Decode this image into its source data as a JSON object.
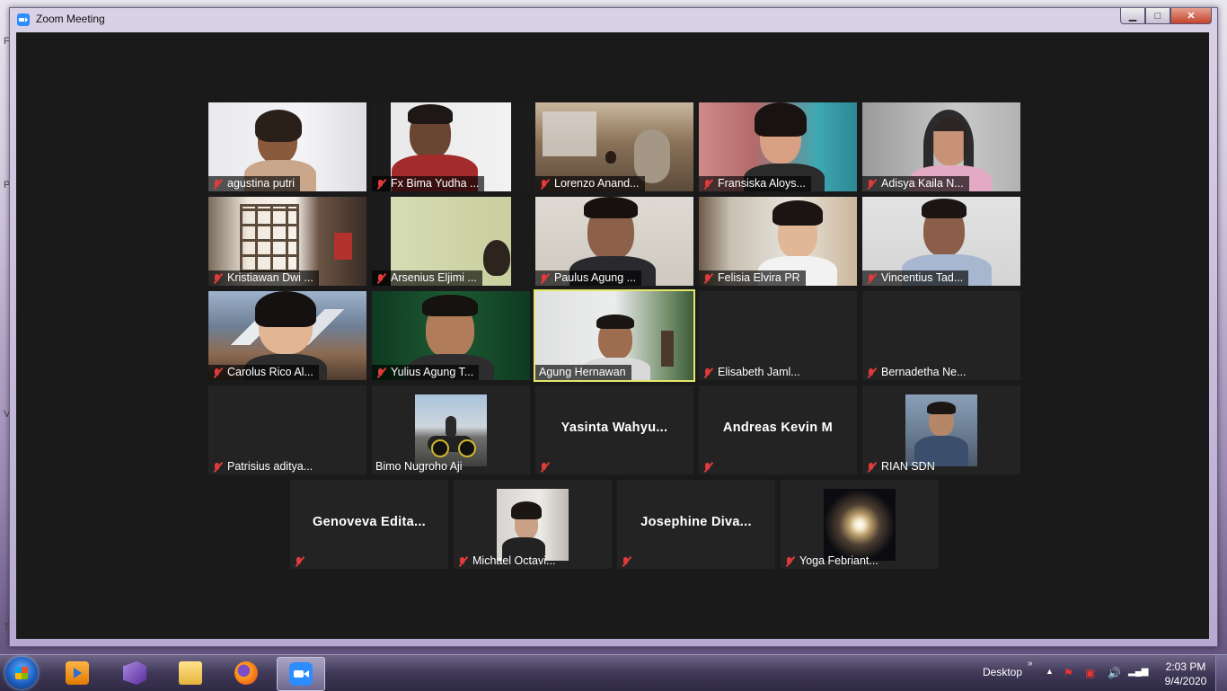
{
  "window": {
    "title": "Zoom Meeting",
    "minimize": "▁",
    "maximize": "□",
    "close": "✕"
  },
  "accent_color": "#e4e86a",
  "mic_muted_color": "#e03b3b",
  "participants": [
    {
      "name": "agustina putri",
      "muted": true
    },
    {
      "name": "Fx Bima Yudha ...",
      "muted": true
    },
    {
      "name": "Lorenzo Anand...",
      "muted": true
    },
    {
      "name": "Fransiska Aloys...",
      "muted": true
    },
    {
      "name": "Adisya Kaila N...",
      "muted": true
    },
    {
      "name": "Kristiawan Dwi ...",
      "muted": true
    },
    {
      "name": "Arsenius Eljimi ...",
      "muted": true
    },
    {
      "name": "Paulus Agung ...",
      "muted": true
    },
    {
      "name": "Felisia Elvira PR",
      "muted": true
    },
    {
      "name": "Vincentius Tad...",
      "muted": true
    },
    {
      "name": "Carolus Rico Al...",
      "muted": true
    },
    {
      "name": "Yulius Agung T...",
      "muted": true
    },
    {
      "name": "Agung Hernawan",
      "muted": false,
      "active_speaker": true
    },
    {
      "name": "Elisabeth Jaml...",
      "muted": true
    },
    {
      "name": "Bernadetha Ne...",
      "muted": true
    },
    {
      "name": "Patrisius aditya...",
      "muted": true
    },
    {
      "name": "Bimo Nugroho Aji",
      "muted": false
    },
    {
      "name": "Yasinta  Wahyu...",
      "muted": true,
      "label": ""
    },
    {
      "name": "Andreas Kevin M",
      "muted": true,
      "label": ""
    },
    {
      "name": "RIAN SDN",
      "muted": true
    },
    {
      "name": "Genoveva  Edita...",
      "muted": true,
      "label": ""
    },
    {
      "name": "Michael Octavi...",
      "muted": true
    },
    {
      "name": "Josephine  Diva...",
      "muted": true,
      "label": ""
    },
    {
      "name": "Yoga Febriant...",
      "muted": true
    }
  ],
  "taskbar": {
    "apps": [
      "start-button",
      "media-player-icon",
      "visual-studio-icon",
      "file-explorer-icon",
      "firefox-icon",
      "zoom-icon"
    ],
    "desktop_label": "Desktop",
    "chevron": "»",
    "time": "2:03 PM",
    "date": "9/4/2020"
  }
}
